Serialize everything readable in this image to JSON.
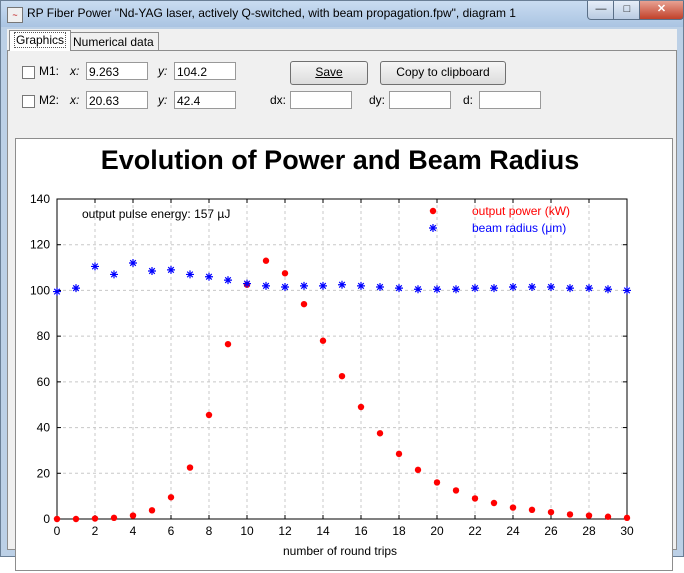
{
  "window": {
    "title": "RP Fiber Power \"Nd-YAG laser, actively Q-switched, with beam propagation.fpw\", diagram 1",
    "min_glyph": "—",
    "max_glyph": "□",
    "close_glyph": "✕"
  },
  "tabs": {
    "graphics": "Graphics",
    "numerical": "Numerical data"
  },
  "cursors": {
    "m1": {
      "label": "M1:",
      "x_label": "x:",
      "x": "9.263",
      "y_label": "y:",
      "y": "104.2"
    },
    "m2": {
      "label": "M2:",
      "x_label": "x:",
      "x": "20.63",
      "y_label": "y:",
      "y": "42.4"
    },
    "dx_label": "dx:",
    "dy_label": "dy:",
    "d_label": "d:",
    "dx": "",
    "dy": "",
    "d": ""
  },
  "buttons": {
    "save": "Save",
    "copy": "Copy to clipboard"
  },
  "chart_data": {
    "type": "scatter",
    "title": "Evolution of Power and Beam Radius",
    "xlabel": "number of round trips",
    "ylabel": "",
    "xlim": [
      0,
      30
    ],
    "ylim": [
      0,
      140
    ],
    "x_ticks": [
      0,
      2,
      4,
      6,
      8,
      10,
      12,
      14,
      16,
      18,
      20,
      22,
      24,
      26,
      28,
      30
    ],
    "y_ticks": [
      0,
      20,
      40,
      60,
      80,
      100,
      120,
      140
    ],
    "grid": true,
    "legend_position": "top-right",
    "annotation": "output pulse energy: 157 µJ",
    "series": [
      {
        "name": "output power (kW)",
        "marker": "dot",
        "color": "#ff0000",
        "x": [
          0,
          1,
          2,
          3,
          4,
          5,
          6,
          7,
          8,
          9,
          10,
          11,
          12,
          13,
          14,
          15,
          16,
          17,
          18,
          19,
          20,
          21,
          22,
          23,
          24,
          25,
          26,
          27,
          28,
          29,
          30
        ],
        "y": [
          0,
          0,
          0.2,
          0.5,
          1.5,
          3.8,
          9.5,
          22.5,
          45.5,
          76.5,
          102.5,
          113,
          107.5,
          94,
          78,
          62.5,
          49,
          37.5,
          28.5,
          21.5,
          16,
          12.5,
          9,
          7,
          5,
          4,
          3,
          2,
          1.5,
          1,
          0.5
        ]
      },
      {
        "name": "beam radius (μm)",
        "marker": "star",
        "color": "#0000ff",
        "x": [
          0,
          1,
          2,
          3,
          4,
          5,
          6,
          7,
          8,
          9,
          10,
          11,
          12,
          13,
          14,
          15,
          16,
          17,
          18,
          19,
          20,
          21,
          22,
          23,
          24,
          25,
          26,
          27,
          28,
          29,
          30
        ],
        "y": [
          99.5,
          101,
          110.5,
          107,
          112,
          108.5,
          109,
          107,
          106,
          104.5,
          103,
          102,
          101.5,
          102,
          102,
          102.5,
          102,
          101.5,
          101,
          100.5,
          100.5,
          100.5,
          101,
          101,
          101.5,
          101.5,
          101.5,
          101,
          101,
          100.5,
          100
        ]
      }
    ]
  }
}
